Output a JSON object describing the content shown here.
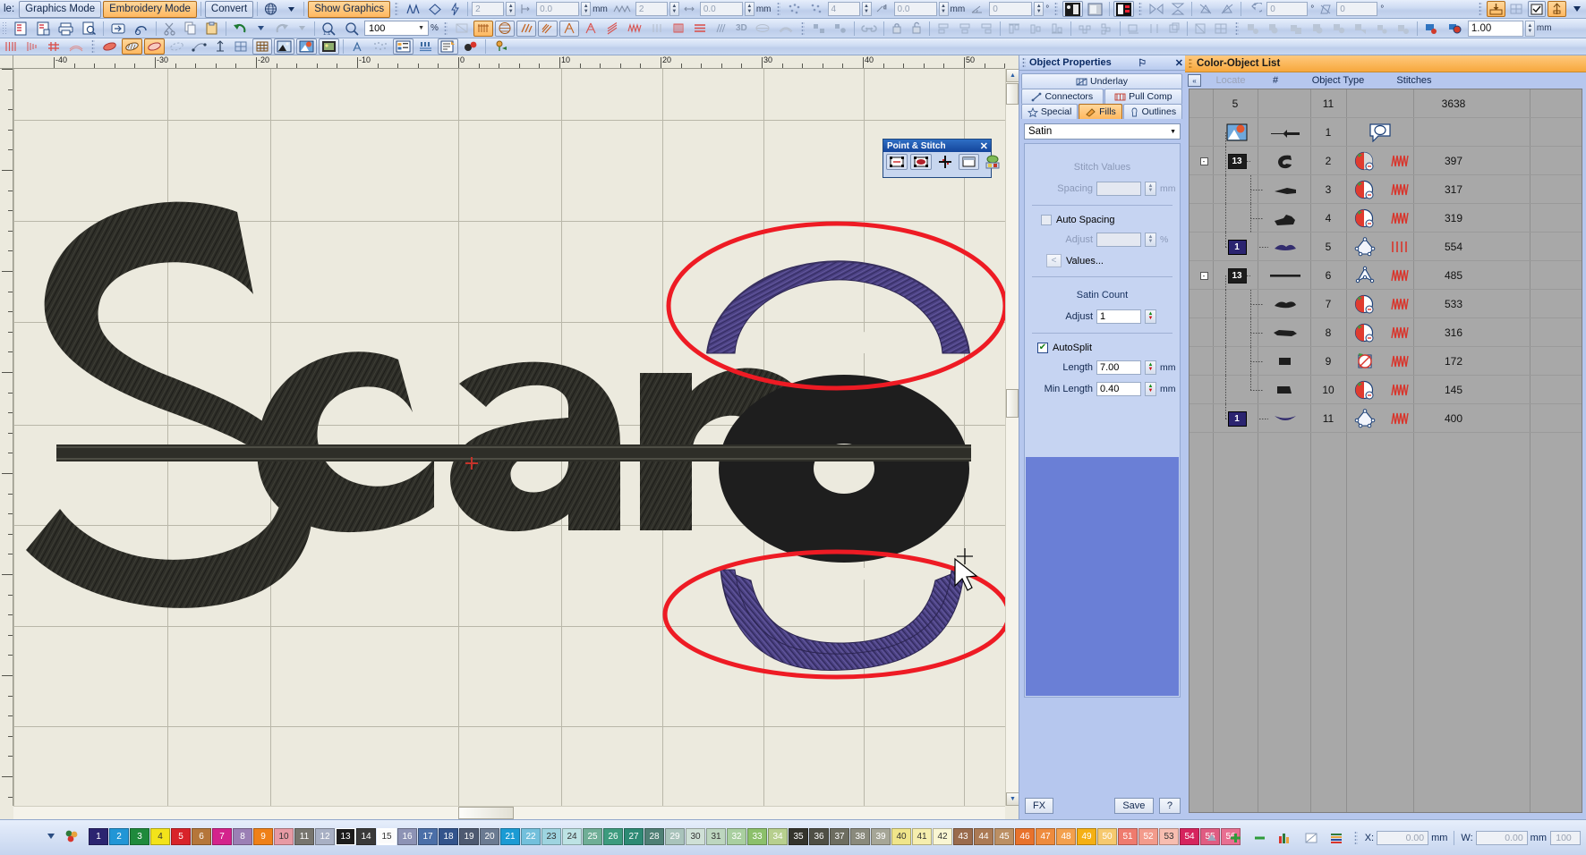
{
  "app": {
    "mode_label": "le:",
    "modes": [
      {
        "id": "graphics-mode",
        "label": "Graphics Mode",
        "active": false
      },
      {
        "id": "embroidery-mode",
        "label": "Embroidery Mode",
        "active": true
      },
      {
        "id": "convert",
        "label": "Convert",
        "active": false
      },
      {
        "id": "show-graphics",
        "label": "Show Graphics",
        "active": true
      }
    ]
  },
  "toolbar_standard": {
    "zoom_value": "100",
    "zoom_unit": "%",
    "buttons": [
      "new-design-icon",
      "open-design-icon",
      "print-icon",
      "print-preview-icon",
      "send-to-machine-icon",
      "machine-format-icon",
      "cut-icon",
      "copy-icon",
      "paste-icon",
      "undo-icon",
      "redo-icon",
      "zoom-1to1-icon",
      "zoom-icon"
    ]
  },
  "toolbar_stitch_params": {
    "fields": [
      {
        "name": "density-count",
        "value": "2",
        "unit": ""
      },
      {
        "name": "density-offset",
        "value": "0.0",
        "unit": "mm"
      },
      {
        "name": "pull-comp-count",
        "value": "2",
        "unit": ""
      },
      {
        "name": "pull-comp-offset",
        "value": "0.0",
        "unit": "mm"
      },
      {
        "name": "underlay-count",
        "value": "4",
        "unit": ""
      },
      {
        "name": "underlay-offset",
        "value": "0.0",
        "unit": "mm"
      },
      {
        "name": "angle",
        "value": "0",
        "unit": "°"
      },
      {
        "name": "rotate-angle",
        "value": "0",
        "unit": "°"
      },
      {
        "name": "skew-angle",
        "value": "0",
        "unit": "°"
      }
    ]
  },
  "toolbar_outline": {
    "offset_value": "1.00",
    "offset_unit": "mm"
  },
  "rulers": {
    "horizontal_labels": [
      "-40",
      "-30",
      "-20",
      "-10",
      "0",
      "10",
      "20",
      "30",
      "40",
      "50"
    ],
    "unit": "mm"
  },
  "point_and_stitch": {
    "title": "Point & Stitch",
    "close_label": "✕",
    "buttons": [
      "stitch-points-icon",
      "stitch-nodes-icon",
      "move-points-icon",
      "select-box-icon",
      "node-tree-icon"
    ]
  },
  "object_properties": {
    "title": "Object Properties",
    "pin_label": "⚐",
    "close_label": "✕",
    "tabs_row1": [
      {
        "label": "Underlay",
        "icon": "underlay-icon",
        "selected": false
      }
    ],
    "tabs_row2": [
      {
        "label": "Connectors",
        "icon": "connectors-icon",
        "selected": false
      },
      {
        "label": "Pull Comp",
        "icon": "pullcomp-icon",
        "selected": false
      }
    ],
    "tabs_row3": [
      {
        "label": "Special",
        "icon": "star-icon",
        "selected": false
      },
      {
        "label": "Fills",
        "icon": "fills-icon",
        "selected": true
      },
      {
        "label": "Outlines",
        "icon": "outlines-icon",
        "selected": false
      }
    ],
    "fill_type": "Satin",
    "stitch_values": {
      "header": "Stitch Values",
      "spacing_label": "Spacing",
      "spacing_value": "",
      "spacing_unit": "mm",
      "auto_spacing_label": "Auto Spacing",
      "auto_spacing_checked": false,
      "adjust_label": "Adjust",
      "adjust_value": "",
      "adjust_unit": "%",
      "values_button": "Values...",
      "values_arrow": "<"
    },
    "satin_count": {
      "header": "Satin Count",
      "adjust_label": "Adjust",
      "adjust_value": "1"
    },
    "autosplit": {
      "label": "AutoSplit",
      "checked": true,
      "check_glyph": "✔",
      "length_label": "Length",
      "length_value": "7.00",
      "length_unit": "mm",
      "min_length_label": "Min Length",
      "min_length_value": "0.40",
      "min_length_unit": "mm"
    },
    "footer": {
      "fx_label": "FX",
      "save_label": "Save",
      "help_label": "?"
    }
  },
  "color_object_list": {
    "title": "Color-Object List",
    "collapse_label": "«",
    "locate_label": "Locate",
    "columns": [
      "#",
      "Object Type",
      "Stitches"
    ],
    "summary": {
      "colors": "5",
      "objects": "11",
      "stitches": "3638"
    },
    "rows": [
      {
        "index": "1",
        "color_num": "",
        "color_hex": "",
        "object_type_icon": "lettering-object-icon",
        "stitch_icon": "",
        "stitches": "",
        "thumb": "scan-object-icon",
        "expander": "",
        "is_color_change": true,
        "color_chip_icon": "artwork-icon"
      },
      {
        "index": "2",
        "color_num": "13",
        "color_hex": "#1c1c1c",
        "object_type_icon": "column-fill-icon",
        "stitch_icon": "satin-stitch-icon",
        "stitches": "397",
        "thumb": "curve-shape",
        "expander": "-"
      },
      {
        "index": "3",
        "color_num": "",
        "color_hex": "",
        "object_type_icon": "column-fill-icon",
        "stitch_icon": "satin-stitch-icon",
        "stitches": "317",
        "thumb": "bar-shape",
        "expander": ""
      },
      {
        "index": "4",
        "color_num": "",
        "color_hex": "",
        "object_type_icon": "column-fill-icon",
        "stitch_icon": "satin-stitch-icon",
        "stitches": "319",
        "thumb": "blob-shape",
        "expander": ""
      },
      {
        "index": "5",
        "color_num": "1",
        "color_hex": "#2b2470",
        "object_type_icon": "complex-fill-icon",
        "stitch_icon": "fill-stitch-icon",
        "stitches": "554",
        "thumb": "arc-shape",
        "expander": "",
        "selected": true
      },
      {
        "index": "6",
        "color_num": "13",
        "color_hex": "#1c1c1c",
        "object_type_icon": "run-outline-icon",
        "stitch_icon": "satin-stitch-icon",
        "stitches": "485",
        "thumb": "line-shape",
        "expander": "-"
      },
      {
        "index": "7",
        "color_num": "",
        "color_hex": "",
        "object_type_icon": "column-fill-icon",
        "stitch_icon": "satin-stitch-icon",
        "stitches": "533",
        "thumb": "swoosh-shape",
        "expander": ""
      },
      {
        "index": "8",
        "color_num": "",
        "color_hex": "",
        "object_type_icon": "column-fill-icon",
        "stitch_icon": "satin-stitch-icon",
        "stitches": "316",
        "thumb": "dash-shape",
        "expander": ""
      },
      {
        "index": "9",
        "color_num": "",
        "color_hex": "",
        "object_type_icon": "no-fill-icon",
        "stitch_icon": "satin-stitch-icon",
        "stitches": "172",
        "thumb": "square-shape",
        "expander": ""
      },
      {
        "index": "10",
        "color_num": "",
        "color_hex": "",
        "object_type_icon": "column-fill-icon",
        "stitch_icon": "satin-stitch-icon",
        "stitches": "145",
        "thumb": "wedge-shape",
        "expander": ""
      },
      {
        "index": "11",
        "color_num": "1",
        "color_hex": "#2b2470",
        "object_type_icon": "complex-fill-icon",
        "stitch_icon": "fill-stitch-icon",
        "stitches": "400",
        "thumb": "bowl-shape",
        "expander": ""
      }
    ]
  },
  "design_canvas": {
    "text_object": "Scano",
    "annotation_color": "#ee1b24",
    "satin_object_color": "#4b4183",
    "text_object_color": "#2e2e28",
    "background": "#eceade"
  },
  "status_bar": {
    "x_label": "X:",
    "x_value": "0.00",
    "x_unit": "mm",
    "w_label": "W:",
    "w_value": "0.00",
    "w_unit": "mm",
    "scale_value": "100"
  },
  "palette": {
    "selected_index": 15,
    "highlight_index": 13,
    "swatches": [
      {
        "n": "1",
        "hex": "#2b2470",
        "fg": "#ffffff"
      },
      {
        "n": "2",
        "hex": "#2196d6",
        "fg": "#ffffff"
      },
      {
        "n": "3",
        "hex": "#1f8a3c",
        "fg": "#ffffff"
      },
      {
        "n": "4",
        "hex": "#f3e31a",
        "fg": "#333333"
      },
      {
        "n": "5",
        "hex": "#d8232a",
        "fg": "#ffffff"
      },
      {
        "n": "6",
        "hex": "#b5763a",
        "fg": "#ffffff"
      },
      {
        "n": "7",
        "hex": "#d4238c",
        "fg": "#ffffff"
      },
      {
        "n": "8",
        "hex": "#9b7fb5",
        "fg": "#ffffff"
      },
      {
        "n": "9",
        "hex": "#ef8018",
        "fg": "#ffffff"
      },
      {
        "n": "10",
        "hex": "#e79aa4",
        "fg": "#333333"
      },
      {
        "n": "11",
        "hex": "#77756e",
        "fg": "#ffffff"
      },
      {
        "n": "12",
        "hex": "#a8b0c4",
        "fg": "#ffffff"
      },
      {
        "n": "13",
        "hex": "#1c1c1c",
        "fg": "#ffffff"
      },
      {
        "n": "14",
        "hex": "#3a3a3a",
        "fg": "#ffffff"
      },
      {
        "n": "15",
        "hex": "#fbfbfb",
        "fg": "#333333"
      },
      {
        "n": "16",
        "hex": "#8d93b5",
        "fg": "#ffffff"
      },
      {
        "n": "17",
        "hex": "#4b6fa8",
        "fg": "#ffffff"
      },
      {
        "n": "18",
        "hex": "#33548c",
        "fg": "#ffffff"
      },
      {
        "n": "19",
        "hex": "#4e5a71",
        "fg": "#ffffff"
      },
      {
        "n": "20",
        "hex": "#6b7b92",
        "fg": "#ffffff"
      },
      {
        "n": "21",
        "hex": "#1b9bd4",
        "fg": "#ffffff"
      },
      {
        "n": "22",
        "hex": "#73c0dc",
        "fg": "#ffffff"
      },
      {
        "n": "23",
        "hex": "#9ed4e0",
        "fg": "#333333"
      },
      {
        "n": "24",
        "hex": "#bde3e4",
        "fg": "#333333"
      },
      {
        "n": "25",
        "hex": "#6fae96",
        "fg": "#ffffff"
      },
      {
        "n": "26",
        "hex": "#3d9b7e",
        "fg": "#ffffff"
      },
      {
        "n": "27",
        "hex": "#2d8a74",
        "fg": "#ffffff"
      },
      {
        "n": "28",
        "hex": "#4f7f75",
        "fg": "#ffffff"
      },
      {
        "n": "29",
        "hex": "#a9c3bb",
        "fg": "#ffffff"
      },
      {
        "n": "30",
        "hex": "#cfe0d6",
        "fg": "#333333"
      },
      {
        "n": "31",
        "hex": "#bdd6bf",
        "fg": "#333333"
      },
      {
        "n": "32",
        "hex": "#a9cfa0",
        "fg": "#ffffff"
      },
      {
        "n": "33",
        "hex": "#8cc06b",
        "fg": "#ffffff"
      },
      {
        "n": "34",
        "hex": "#b7cf8e",
        "fg": "#ffffff"
      },
      {
        "n": "35",
        "hex": "#34342c",
        "fg": "#ffffff"
      },
      {
        "n": "36",
        "hex": "#4f4f45",
        "fg": "#ffffff"
      },
      {
        "n": "37",
        "hex": "#6d6d60",
        "fg": "#ffffff"
      },
      {
        "n": "38",
        "hex": "#8a8a7c",
        "fg": "#ffffff"
      },
      {
        "n": "39",
        "hex": "#a6a697",
        "fg": "#ffffff"
      },
      {
        "n": "40",
        "hex": "#f0e58a",
        "fg": "#333333"
      },
      {
        "n": "41",
        "hex": "#f6eeae",
        "fg": "#333333"
      },
      {
        "n": "42",
        "hex": "#faf6d3",
        "fg": "#333333"
      },
      {
        "n": "43",
        "hex": "#9a6b4d",
        "fg": "#ffffff"
      },
      {
        "n": "44",
        "hex": "#ab7a55",
        "fg": "#ffffff"
      },
      {
        "n": "45",
        "hex": "#bb8f63",
        "fg": "#ffffff"
      },
      {
        "n": "46",
        "hex": "#e8722c",
        "fg": "#ffffff"
      },
      {
        "n": "47",
        "hex": "#ee8b3d",
        "fg": "#ffffff"
      },
      {
        "n": "48",
        "hex": "#f3a04d",
        "fg": "#ffffff"
      },
      {
        "n": "49",
        "hex": "#f5b014",
        "fg": "#ffffff"
      },
      {
        "n": "50",
        "hex": "#f6c96e",
        "fg": "#ffffff"
      },
      {
        "n": "51",
        "hex": "#ef7b6e",
        "fg": "#ffffff"
      },
      {
        "n": "52",
        "hex": "#f39b8c",
        "fg": "#ffffff"
      },
      {
        "n": "53",
        "hex": "#f7bdb0",
        "fg": "#333333"
      },
      {
        "n": "54",
        "hex": "#d6245e",
        "fg": "#ffffff"
      },
      {
        "n": "55",
        "hex": "#e05c82",
        "fg": "#ffffff"
      },
      {
        "n": "56",
        "hex": "#e86f92",
        "fg": "#ffffff"
      }
    ]
  }
}
